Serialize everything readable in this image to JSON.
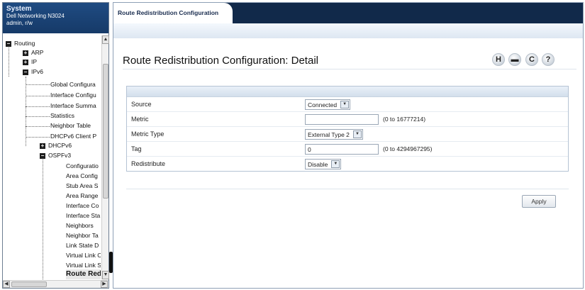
{
  "sidebar": {
    "system_title": "System",
    "device_name": "Dell Networking N3024",
    "user": "admin, r/w",
    "tree": [
      {
        "label": "Routing",
        "toggle": "−"
      },
      {
        "label": "ARP",
        "toggle": "+"
      },
      {
        "label": "IP",
        "toggle": "+"
      },
      {
        "label": "IPv6",
        "toggle": "−"
      },
      {
        "label": "Global Configura"
      },
      {
        "label": "Interface Configu"
      },
      {
        "label": "Interface Summa"
      },
      {
        "label": "Statistics"
      },
      {
        "label": "Neighbor Table"
      },
      {
        "label": "DHCPv6 Client P"
      },
      {
        "label": "DHCPv6",
        "toggle": "+"
      },
      {
        "label": "OSPFv3",
        "toggle": "−"
      },
      {
        "label": "Configuratio"
      },
      {
        "label": "Area Config"
      },
      {
        "label": "Stub Area S"
      },
      {
        "label": "Area Range"
      },
      {
        "label": "Interface Co"
      },
      {
        "label": "Interface Sta"
      },
      {
        "label": "Neighbors"
      },
      {
        "label": "Neighbor Ta"
      },
      {
        "label": "Link State D"
      },
      {
        "label": "Virtual Link C"
      },
      {
        "label": "Virtual Link S"
      },
      {
        "label": "Route Red"
      }
    ]
  },
  "header": {
    "tab_label": "Route Redistribution Configuration"
  },
  "main": {
    "title": "Route Redistribution Configuration: Detail",
    "icons": [
      "save-icon",
      "print-icon",
      "refresh-icon",
      "help-icon"
    ],
    "icon_glyphs": {
      "save": "H",
      "print": "▬",
      "refresh": "C",
      "help": "?"
    },
    "fields": {
      "source": {
        "label": "Source",
        "value": "Connected"
      },
      "metric": {
        "label": "Metric",
        "value": "",
        "hint": "(0 to 16777214)"
      },
      "metric_type": {
        "label": "Metric Type",
        "value": "External Type 2"
      },
      "tag": {
        "label": "Tag",
        "value": "0",
        "hint": "(0 to 4294967295)"
      },
      "redistribute": {
        "label": "Redistribute",
        "value": "Disable"
      }
    },
    "apply_label": "Apply"
  },
  "colors": {
    "header_bg": "#163a68",
    "tabbar_bg": "#11294a",
    "form_border": "#b5c3d4"
  }
}
